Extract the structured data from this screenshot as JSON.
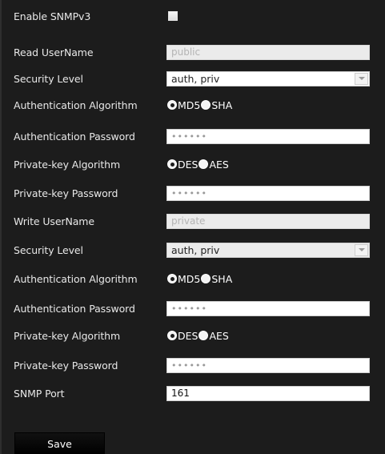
{
  "form": {
    "enable_snmpv3": {
      "label": "Enable SNMPv3",
      "checked": false
    },
    "read": {
      "username_label": "Read UserName",
      "username_value": "public",
      "security_level_label": "Security Level",
      "security_level_value": "auth, priv",
      "auth_algorithm_label": "Authentication Algorithm",
      "auth_options": [
        "MD5",
        "SHA"
      ],
      "auth_selected": "MD5",
      "auth_password_label": "Authentication Password",
      "auth_password_value": "••••••",
      "priv_algorithm_label": "Private-key Algorithm",
      "priv_options": [
        "DES",
        "AES"
      ],
      "priv_selected": "DES",
      "priv_password_label": "Private-key Password",
      "priv_password_value": "••••••"
    },
    "write": {
      "username_label": "Write UserName",
      "username_value": "private",
      "security_level_label": "Security Level",
      "security_level_value": "auth, priv",
      "auth_algorithm_label": "Authentication Algorithm",
      "auth_options": [
        "MD5",
        "SHA"
      ],
      "auth_selected": "MD5",
      "auth_password_label": "Authentication Password",
      "auth_password_value": "••••••",
      "priv_algorithm_label": "Private-key Algorithm",
      "priv_options": [
        "DES",
        "AES"
      ],
      "priv_selected": "DES",
      "priv_password_label": "Private-key Password",
      "priv_password_value": "••••••"
    },
    "snmp_port": {
      "label": "SNMP Port",
      "value": "161"
    }
  },
  "actions": {
    "save_label": "Save"
  },
  "icons": {
    "dropdown": "chevron-down-icon"
  }
}
